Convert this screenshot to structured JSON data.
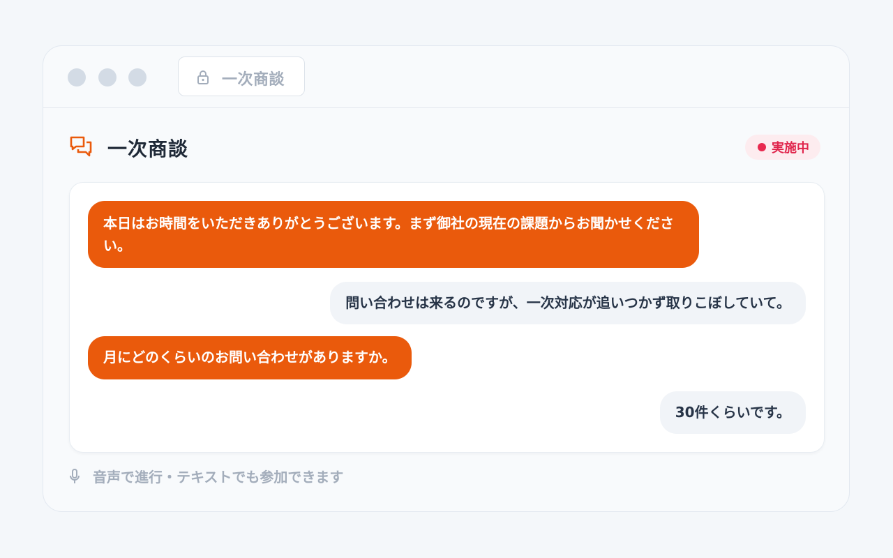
{
  "window": {
    "tab": {
      "label": "一次商談",
      "icon": "lock-icon"
    }
  },
  "header": {
    "title": "一次商談",
    "icon": "chat-bubbles-icon",
    "status": {
      "label": "実施中",
      "color": "#e8294f"
    }
  },
  "messages": [
    {
      "role": "agent",
      "text": "本日はお時間をいただきありがとうございます。まず御社の現在の課題からお聞かせください。"
    },
    {
      "role": "user",
      "text": "問い合わせは来るのですが、一次対応が追いつかず取りこぼしていて。"
    },
    {
      "role": "agent",
      "text": "月にどのくらいのお問い合わせがありますか。"
    },
    {
      "role": "user",
      "text": "30件くらいです。"
    }
  ],
  "footer": {
    "icon": "microphone-icon",
    "text": "音声で進行・テキストでも参加できます"
  },
  "colors": {
    "accent": "#ea5a0c",
    "user_bubble": "#f1f4f8",
    "status_bg": "#fdecef"
  }
}
